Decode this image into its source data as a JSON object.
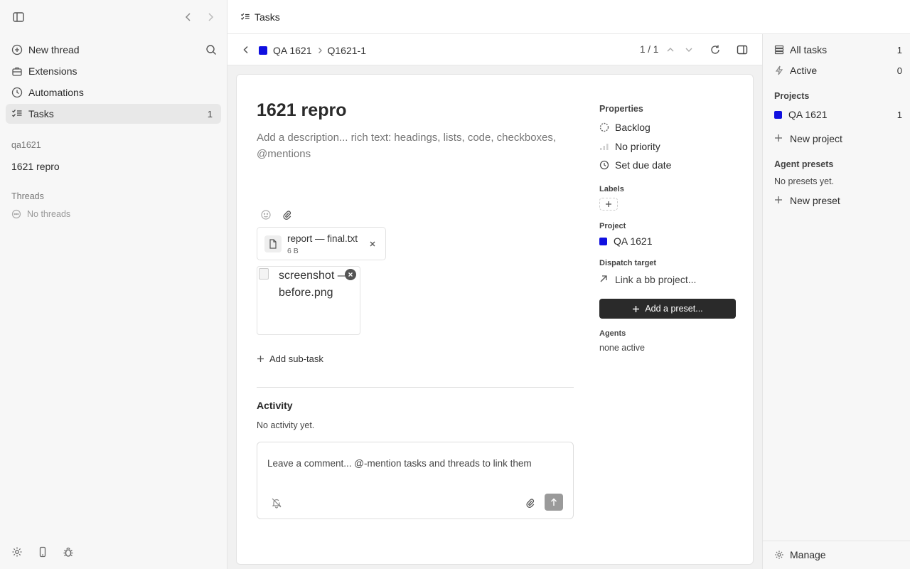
{
  "left": {
    "new_thread": "New thread",
    "extensions": "Extensions",
    "automations": "Automations",
    "tasks": "Tasks",
    "tasks_count": "1",
    "group_label": "qa1621",
    "group_item": "1621 repro",
    "threads_label": "Threads",
    "no_threads": "No threads"
  },
  "topbar": {
    "title": "Tasks"
  },
  "subbar": {
    "project": "QA 1621",
    "task_id": "Q1621-1",
    "pager": "1 / 1",
    "project_color": "#1010e0"
  },
  "task": {
    "title": "1621 repro",
    "description_placeholder": "Add a description... rich text: headings, lists, code, checkboxes, @mentions",
    "attachment_name": "report — final.txt",
    "attachment_size": "6 B",
    "image_alt": "screenshot — before.png",
    "add_subtask": "Add sub-task",
    "activity_heading": "Activity",
    "activity_empty": "No activity yet.",
    "comment_placeholder": "Leave a comment... @-mention tasks and threads to link them"
  },
  "properties": {
    "heading": "Properties",
    "status": "Backlog",
    "priority": "No priority",
    "due_date": "Set due date",
    "labels_heading": "Labels",
    "project_heading": "Project",
    "project": "QA 1621",
    "dispatch_heading": "Dispatch target",
    "dispatch_link": "Link a bb project...",
    "add_preset": "Add a preset...",
    "agents_heading": "Agents",
    "agents_value": "none active"
  },
  "right": {
    "all_tasks": "All tasks",
    "all_tasks_count": "1",
    "active": "Active",
    "active_count": "0",
    "projects_heading": "Projects",
    "project": "QA 1621",
    "project_count": "1",
    "new_project": "New project",
    "presets_heading": "Agent presets",
    "no_presets": "No presets yet.",
    "new_preset": "New preset",
    "manage": "Manage"
  }
}
